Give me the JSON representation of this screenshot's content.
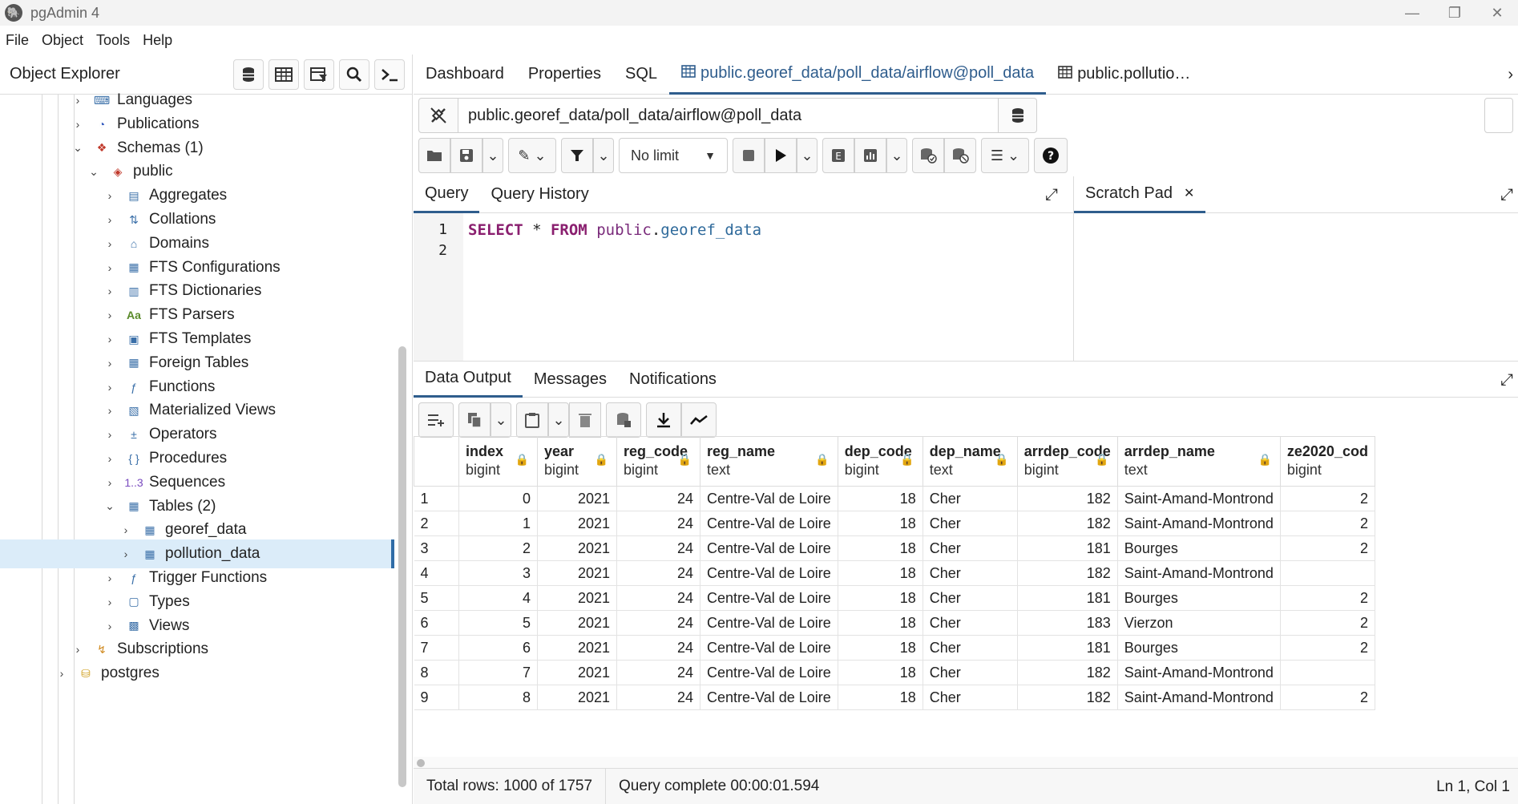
{
  "window": {
    "title": "pgAdmin 4",
    "minimize": "—",
    "restore": "❐",
    "close": "✕"
  },
  "menu": [
    "File",
    "Object",
    "Tools",
    "Help"
  ],
  "explorer": {
    "title": "Object Explorer",
    "tree": [
      {
        "label": "Languages",
        "indent": 1,
        "expanded": false
      },
      {
        "label": "Publications",
        "indent": 1,
        "expanded": false
      },
      {
        "label": "Schemas (1)",
        "indent": 1,
        "expanded": true
      },
      {
        "label": "public",
        "indent": 2,
        "expanded": true
      },
      {
        "label": "Aggregates",
        "indent": 3,
        "expanded": false
      },
      {
        "label": "Collations",
        "indent": 3,
        "expanded": false
      },
      {
        "label": "Domains",
        "indent": 3,
        "expanded": false
      },
      {
        "label": "FTS Configurations",
        "indent": 3,
        "expanded": false
      },
      {
        "label": "FTS Dictionaries",
        "indent": 3,
        "expanded": false
      },
      {
        "label": "FTS Parsers",
        "indent": 3,
        "expanded": false
      },
      {
        "label": "FTS Templates",
        "indent": 3,
        "expanded": false
      },
      {
        "label": "Foreign Tables",
        "indent": 3,
        "expanded": false
      },
      {
        "label": "Functions",
        "indent": 3,
        "expanded": false
      },
      {
        "label": "Materialized Views",
        "indent": 3,
        "expanded": false
      },
      {
        "label": "Operators",
        "indent": 3,
        "expanded": false
      },
      {
        "label": "Procedures",
        "indent": 3,
        "expanded": false
      },
      {
        "label": "Sequences",
        "indent": 3,
        "expanded": false
      },
      {
        "label": "Tables (2)",
        "indent": 3,
        "expanded": true
      },
      {
        "label": "georef_data",
        "indent": 4,
        "expanded": false
      },
      {
        "label": "pollution_data",
        "indent": 4,
        "expanded": false,
        "selected": true
      },
      {
        "label": "Trigger Functions",
        "indent": 3,
        "expanded": false
      },
      {
        "label": "Types",
        "indent": 3,
        "expanded": false
      },
      {
        "label": "Views",
        "indent": 3,
        "expanded": false
      },
      {
        "label": "Subscriptions",
        "indent": 1,
        "expanded": false
      },
      {
        "label": "postgres",
        "indent": 0,
        "expanded": false
      }
    ]
  },
  "tabs": [
    {
      "label": "Dashboard"
    },
    {
      "label": "Properties"
    },
    {
      "label": "SQL"
    },
    {
      "label": "public.georef_data/poll_data/airflow@poll_data",
      "active": true
    },
    {
      "label": "public.pollutio…"
    }
  ],
  "connection": "public.georef_data/poll_data/airflow@poll_data",
  "limit": "No limit",
  "query_tabs": [
    "Query",
    "Query History"
  ],
  "scratch_pad": "Scratch Pad",
  "editor": {
    "line_numbers": [
      "1",
      "2"
    ],
    "kw1": "SELECT",
    "star": " * ",
    "kw2": "FROM",
    "schema": "public",
    "dot": ".",
    "table": "georef_data"
  },
  "result_tabs": [
    "Data Output",
    "Messages",
    "Notifications"
  ],
  "columns": [
    {
      "name": "index",
      "type": "bigint"
    },
    {
      "name": "year",
      "type": "bigint"
    },
    {
      "name": "reg_code",
      "type": "bigint"
    },
    {
      "name": "reg_name",
      "type": "text"
    },
    {
      "name": "dep_code",
      "type": "bigint"
    },
    {
      "name": "dep_name",
      "type": "text"
    },
    {
      "name": "arrdep_code",
      "type": "bigint"
    },
    {
      "name": "arrdep_name",
      "type": "text"
    },
    {
      "name": "ze2020_cod",
      "type": "bigint"
    }
  ],
  "rows": [
    [
      "1",
      "0",
      "2021",
      "24",
      "Centre-Val de Loire",
      "18",
      "Cher",
      "182",
      "Saint-Amand-Montrond",
      "2"
    ],
    [
      "2",
      "1",
      "2021",
      "24",
      "Centre-Val de Loire",
      "18",
      "Cher",
      "182",
      "Saint-Amand-Montrond",
      "2"
    ],
    [
      "3",
      "2",
      "2021",
      "24",
      "Centre-Val de Loire",
      "18",
      "Cher",
      "181",
      "Bourges",
      "2"
    ],
    [
      "4",
      "3",
      "2021",
      "24",
      "Centre-Val de Loire",
      "18",
      "Cher",
      "182",
      "Saint-Amand-Montrond",
      ""
    ],
    [
      "5",
      "4",
      "2021",
      "24",
      "Centre-Val de Loire",
      "18",
      "Cher",
      "181",
      "Bourges",
      "2"
    ],
    [
      "6",
      "5",
      "2021",
      "24",
      "Centre-Val de Loire",
      "18",
      "Cher",
      "183",
      "Vierzon",
      "2"
    ],
    [
      "7",
      "6",
      "2021",
      "24",
      "Centre-Val de Loire",
      "18",
      "Cher",
      "181",
      "Bourges",
      "2"
    ],
    [
      "8",
      "7",
      "2021",
      "24",
      "Centre-Val de Loire",
      "18",
      "Cher",
      "182",
      "Saint-Amand-Montrond",
      ""
    ],
    [
      "9",
      "8",
      "2021",
      "24",
      "Centre-Val de Loire",
      "18",
      "Cher",
      "182",
      "Saint-Amand-Montrond",
      "2"
    ]
  ],
  "status": {
    "total_rows": "Total rows: 1000 of 1757",
    "query_complete": "Query complete 00:00:01.594",
    "cursor": "Ln 1, Col 1"
  },
  "colors": {
    "accent": "#2f5d8d",
    "selection": "#dbecf9"
  }
}
